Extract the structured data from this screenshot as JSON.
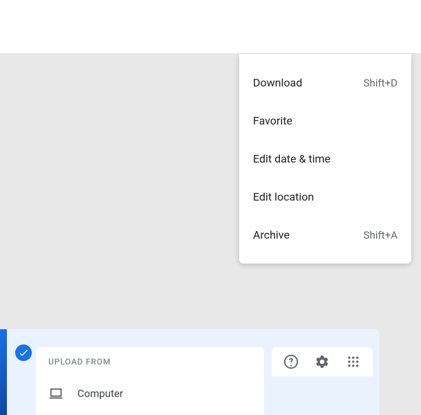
{
  "context_menu": {
    "items": [
      {
        "label": "Download",
        "shortcut": "Shift+D"
      },
      {
        "label": "Favorite",
        "shortcut": ""
      },
      {
        "label": "Edit date & time",
        "shortcut": ""
      },
      {
        "label": "Edit location",
        "shortcut": ""
      },
      {
        "label": "Archive",
        "shortcut": "Shift+A"
      }
    ]
  },
  "upload": {
    "header": "UPLOAD FROM",
    "options": [
      {
        "label": "Computer",
        "icon": "computer-icon"
      }
    ]
  }
}
